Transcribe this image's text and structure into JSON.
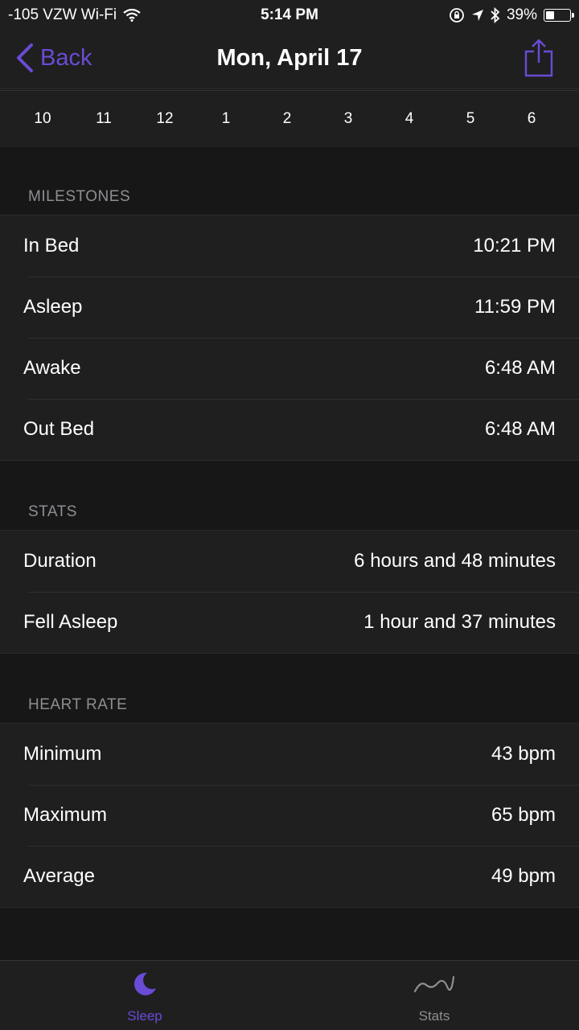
{
  "status_bar": {
    "carrier": "-105 VZW Wi-Fi",
    "time": "5:14 PM",
    "battery": "39%",
    "battery_level": 0.39
  },
  "nav": {
    "back_label": "Back",
    "title": "Mon, April 17"
  },
  "timeline": {
    "ticks": [
      "10",
      "11",
      "12",
      "1",
      "2",
      "3",
      "4",
      "5",
      "6"
    ]
  },
  "milestones": {
    "header": "MILESTONES",
    "rows": [
      {
        "label": "In Bed",
        "value": "10:21 PM"
      },
      {
        "label": "Asleep",
        "value": "11:59 PM"
      },
      {
        "label": "Awake",
        "value": "6:48 AM"
      },
      {
        "label": "Out Bed",
        "value": "6:48 AM"
      }
    ]
  },
  "stats": {
    "header": "STATS",
    "rows": [
      {
        "label": "Duration",
        "value": "6 hours and 48 minutes"
      },
      {
        "label": "Fell Asleep",
        "value": "1 hour and 37 minutes"
      }
    ]
  },
  "heart_rate": {
    "header": "HEART RATE",
    "rows": [
      {
        "label": "Minimum",
        "value": "43 bpm"
      },
      {
        "label": "Maximum",
        "value": "65 bpm"
      },
      {
        "label": "Average",
        "value": "49 bpm"
      }
    ]
  },
  "tabs": {
    "sleep": "Sleep",
    "stats": "Stats"
  },
  "colors": {
    "accent": "#6a4bd6",
    "background": "#171717",
    "cell": "#1f1f1f",
    "secondary_text": "#8e8e93"
  }
}
